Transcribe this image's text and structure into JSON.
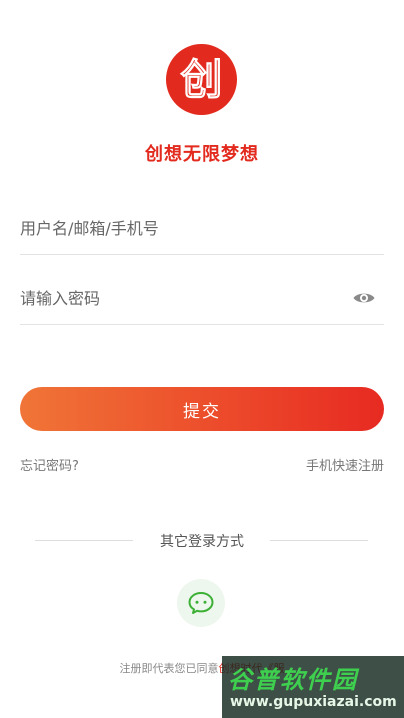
{
  "logo": {
    "text": "创",
    "color": "#e32a1e"
  },
  "slogan": "创想无限梦想",
  "form": {
    "username": {
      "placeholder": "用户名/邮箱/手机号",
      "value": ""
    },
    "password": {
      "placeholder": "请输入密码",
      "value": "",
      "toggle_icon": "eye-icon"
    },
    "submit_label": "提交",
    "forgot_password": "忘记密码?",
    "phone_register": "手机快速注册"
  },
  "other_login": {
    "label": "其它登录方式",
    "providers": [
      {
        "name": "wechat",
        "icon": "wechat-icon",
        "color": "#3cb035"
      }
    ]
  },
  "agreement": {
    "prefix": "注册即代表您已同意",
    "link_text": "创想时代《服"
  },
  "watermark": {
    "title": "谷普软件园",
    "url": "www.gupuxiazai.com"
  },
  "colors": {
    "accent": "#e32a1e",
    "button_gradient_start": "#f07537",
    "button_gradient_end": "#e72a22"
  }
}
